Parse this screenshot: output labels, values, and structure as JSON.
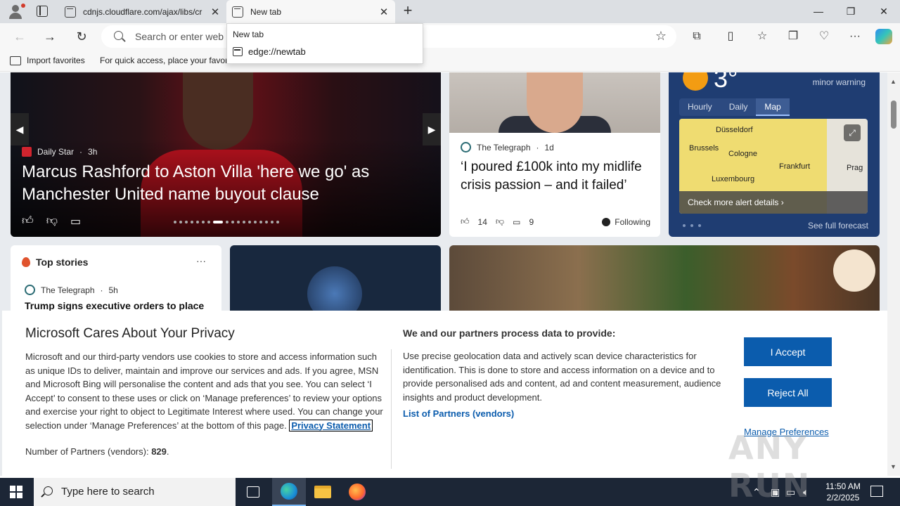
{
  "browser": {
    "tabs": [
      {
        "title": "cdnjs.cloudflare.com/ajax/libs/cr",
        "active": false
      },
      {
        "title": "New tab",
        "active": true
      }
    ],
    "window_controls": {
      "minimize": "—",
      "maximize": "❐",
      "close": "✕"
    },
    "address_bar": {
      "placeholder": "Search or enter web address",
      "value": ""
    },
    "favorites_bar": {
      "import_label": "Import favorites",
      "hint": "For quick access, place your favorites here on the favorites bar."
    },
    "omnibox_dropdown": {
      "header": "New tab",
      "suggestion": "edge://newtab"
    }
  },
  "feed": {
    "hero": {
      "source": "Daily Star",
      "age": "3h",
      "headline": "Marcus Rashford to Aston Villa 'here we go' as Manchester United name buyout clause"
    },
    "card2": {
      "source": "The Telegraph",
      "age": "1d",
      "headline": "‘I poured £100k into my midlife crisis passion – and it failed’",
      "likes": "14",
      "comments": "9",
      "following_label": "Following"
    },
    "weather": {
      "temp": "3",
      "warning": "minor warning",
      "tabs": [
        "Hourly",
        "Daily",
        "Map"
      ],
      "selected_tab": "Map",
      "map_labels": [
        "Düsseldorf",
        "Brussels",
        "Cologne",
        "Frankfurt",
        "Luxembourg",
        "Prag"
      ],
      "alert_link": "Check more alert details",
      "forecast_link": "See full forecast"
    },
    "top_stories": {
      "title": "Top stories",
      "source": "The Telegraph",
      "age": "5h",
      "headline": "Trump signs executive orders to place"
    }
  },
  "privacy": {
    "title": "Microsoft Cares About Your Privacy",
    "body": "Microsoft and our third-party vendors use cookies to store and access information such as unique IDs to deliver, maintain and improve our services and ads. If you agree, MSN and Microsoft Bing will personalise the content and ads that you see. You can select ‘I Accept’ to consent to these uses or click on ‘Manage preferences’ to review your options and exercise your right to object to Legitimate Interest where used.  You can change your selection under ‘Manage Preferences’ at the bottom of this page.",
    "privacy_link": "Privacy Statement",
    "partners_label": "Number of Partners (vendors):",
    "partners_count": "829",
    "partners_suffix": ".",
    "right_title": "We and our partners process data to provide:",
    "right_body": "Use precise geolocation data and actively scan device characteristics for identification. This is done to store and access information on a device and to provide personalised ads and content, ad and content measurement, audience insights and product development.",
    "vendors_link": "List of Partners (vendors)",
    "accept_label": "I Accept",
    "reject_label": "Reject All",
    "manage_label": "Manage Preferences"
  },
  "watermark": "ANY RUN",
  "taskbar": {
    "search_placeholder": "Type here to search",
    "time": "11:50 AM",
    "date": "2/2/2025"
  },
  "colors": {
    "accent": "#0b5cad",
    "taskbar": "#1c2636",
    "weather_card": "#1f3d72"
  }
}
